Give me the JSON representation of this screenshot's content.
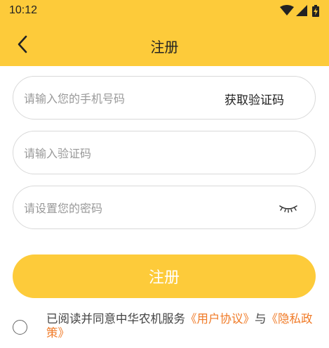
{
  "status_bar": {
    "time": "10:12",
    "icons": [
      "wifi-icon",
      "cellular-signal-icon",
      "battery-charging-icon"
    ]
  },
  "app_bar": {
    "title": "注册",
    "back_icon": "chevron-left-icon"
  },
  "form": {
    "phone_placeholder": "请输入您的手机号码",
    "get_code_label": "获取验证码",
    "code_placeholder": "请输入验证码",
    "password_placeholder": "请设置您的密码",
    "password_toggle_icon": "eye-closed-icon"
  },
  "register_button_label": "注册",
  "agreement": {
    "prefix": "已阅读并同意中华农机服务",
    "user_agreement_link": "《用户协议》",
    "connector": "与",
    "privacy_policy_link": "《隐私政策》",
    "checked": false
  },
  "colors": {
    "brand_yellow": "#FDCB3A",
    "link_orange": "#F07A26",
    "field_border": "#d9d9d9",
    "placeholder_gray": "#999999"
  }
}
